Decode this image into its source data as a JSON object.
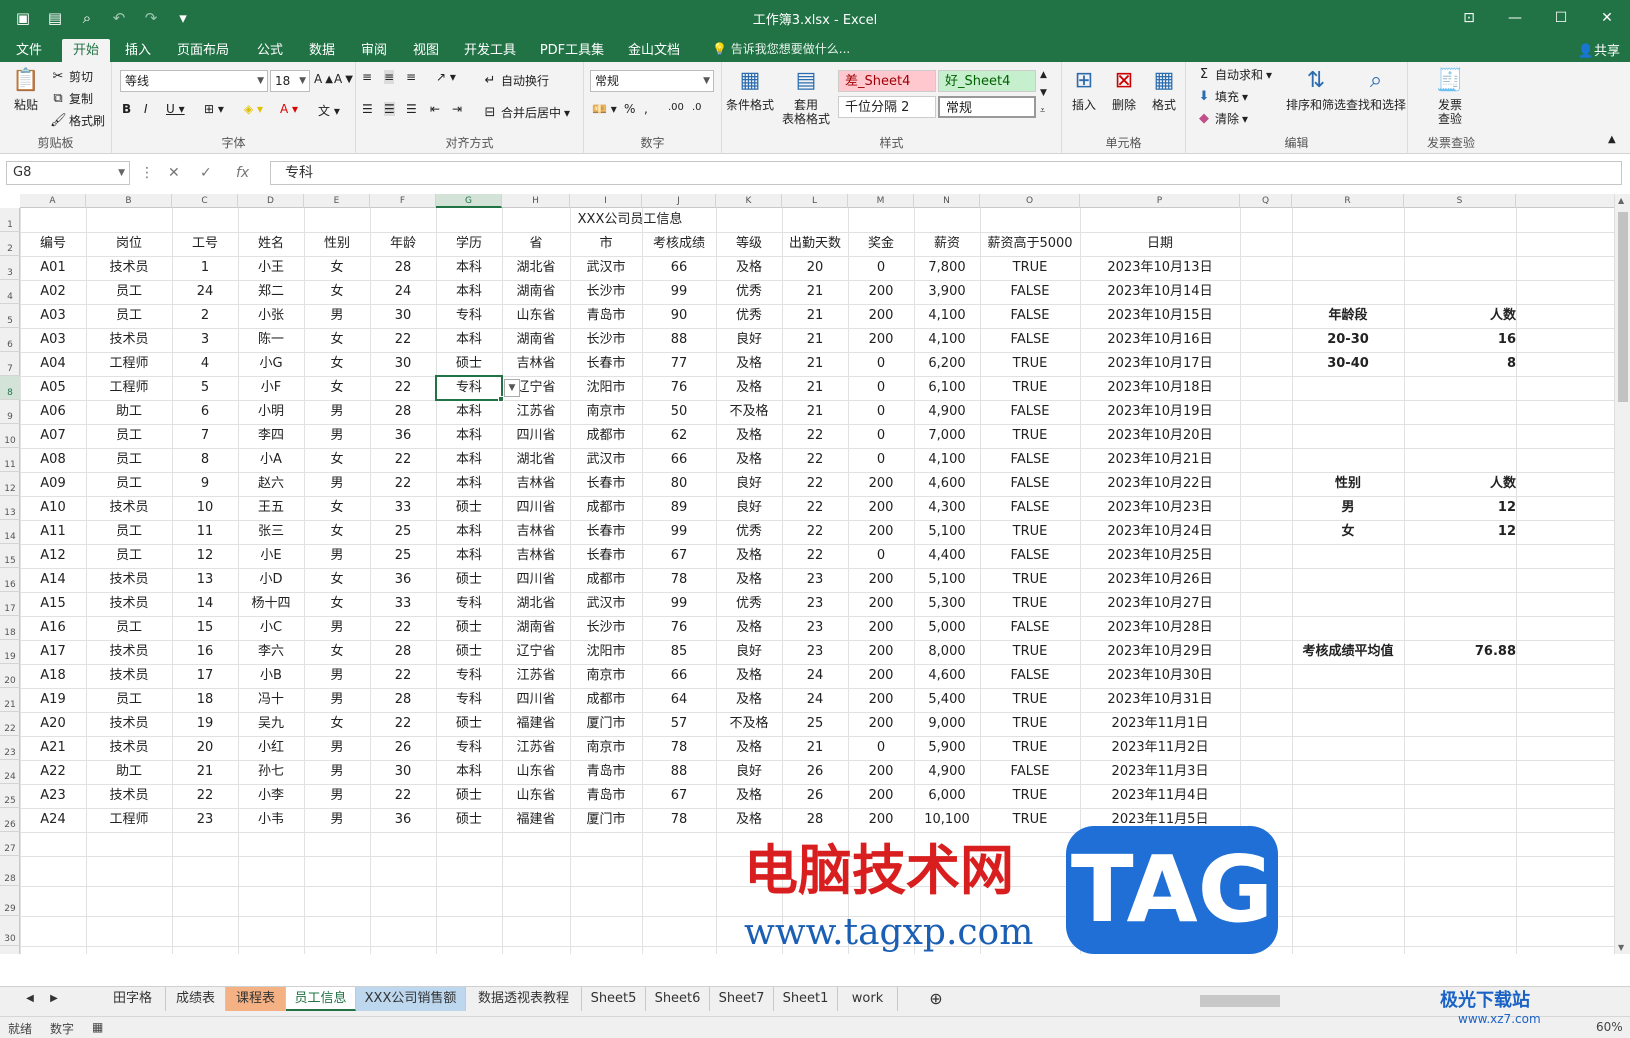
{
  "window": {
    "title": "工作簿3.xlsx - Excel"
  },
  "menu": {
    "tabs": [
      "文件",
      "开始",
      "插入",
      "页面布局",
      "公式",
      "数据",
      "审阅",
      "视图",
      "开发工具",
      "PDF工具集",
      "金山文档"
    ],
    "active": "开始",
    "tell_me": "告诉我您想要做什么...",
    "share": "共享"
  },
  "ribbon": {
    "clipboard": {
      "label": "剪贴板",
      "paste": "粘贴",
      "cut": "剪切",
      "copy": "复制",
      "format_painter": "格式刷"
    },
    "font": {
      "label": "字体",
      "name": "等线",
      "size": "18"
    },
    "align": {
      "label": "对齐方式",
      "wrap": "自动换行",
      "merge": "合并后居中"
    },
    "number": {
      "label": "数字",
      "format": "常规"
    },
    "styles": {
      "label": "样式",
      "cond": "条件格式",
      "table": "套用\n表格格式",
      "s1": "差_Sheet4",
      "s2": "好_Sheet4",
      "s3": "千位分隔 2",
      "s4": "常规"
    },
    "cells": {
      "label": "单元格",
      "insert": "插入",
      "delete": "删除",
      "format": "格式"
    },
    "edit": {
      "label": "编辑",
      "autosum": "自动求和",
      "fill": "填充",
      "clear": "清除",
      "sort": "排序和筛选",
      "find": "查找和选择"
    },
    "invoice": {
      "label": "发票查验",
      "btn": "发票\n查验"
    }
  },
  "formula_bar": {
    "name_box": "G8",
    "content": "专科"
  },
  "sheet": {
    "title": "XXX公司员工信息",
    "headers": [
      "编号",
      "岗位",
      "工号",
      "姓名",
      "性别",
      "年龄",
      "学历",
      "省",
      "市",
      "考核成绩",
      "等级",
      "出勤天数",
      "奖金",
      "薪资",
      "薪资高于5000",
      "日期"
    ],
    "rows": [
      [
        "A01",
        "技术员",
        "1",
        "小王",
        "女",
        "28",
        "本科",
        "湖北省",
        "武汉市",
        "66",
        "及格",
        "20",
        "0",
        "7,800",
        "TRUE",
        "2023年10月13日"
      ],
      [
        "A02",
        "员工",
        "24",
        "郑二",
        "女",
        "24",
        "本科",
        "湖南省",
        "长沙市",
        "99",
        "优秀",
        "21",
        "200",
        "3,900",
        "FALSE",
        "2023年10月14日"
      ],
      [
        "A03",
        "员工",
        "2",
        "小张",
        "男",
        "30",
        "专科",
        "山东省",
        "青岛市",
        "90",
        "优秀",
        "21",
        "200",
        "4,100",
        "FALSE",
        "2023年10月15日"
      ],
      [
        "A03",
        "技术员",
        "3",
        "陈一",
        "女",
        "22",
        "本科",
        "湖南省",
        "长沙市",
        "88",
        "良好",
        "21",
        "200",
        "4,100",
        "FALSE",
        "2023年10月16日"
      ],
      [
        "A04",
        "工程师",
        "4",
        "小G",
        "女",
        "30",
        "硕士",
        "吉林省",
        "长春市",
        "77",
        "及格",
        "21",
        "0",
        "6,200",
        "TRUE",
        "2023年10月17日"
      ],
      [
        "A05",
        "工程师",
        "5",
        "小F",
        "女",
        "22",
        "专科",
        "辽宁省",
        "沈阳市",
        "76",
        "及格",
        "21",
        "0",
        "6,100",
        "TRUE",
        "2023年10月18日"
      ],
      [
        "A06",
        "助工",
        "6",
        "小明",
        "男",
        "28",
        "本科",
        "江苏省",
        "南京市",
        "50",
        "不及格",
        "21",
        "0",
        "4,900",
        "FALSE",
        "2023年10月19日"
      ],
      [
        "A07",
        "员工",
        "7",
        "李四",
        "男",
        "36",
        "本科",
        "四川省",
        "成都市",
        "62",
        "及格",
        "22",
        "0",
        "7,000",
        "TRUE",
        "2023年10月20日"
      ],
      [
        "A08",
        "员工",
        "8",
        "小A",
        "女",
        "22",
        "本科",
        "湖北省",
        "武汉市",
        "66",
        "及格",
        "22",
        "0",
        "4,100",
        "FALSE",
        "2023年10月21日"
      ],
      [
        "A09",
        "员工",
        "9",
        "赵六",
        "男",
        "22",
        "本科",
        "吉林省",
        "长春市",
        "80",
        "良好",
        "22",
        "200",
        "4,600",
        "FALSE",
        "2023年10月22日"
      ],
      [
        "A10",
        "技术员",
        "10",
        "王五",
        "女",
        "33",
        "硕士",
        "四川省",
        "成都市",
        "89",
        "良好",
        "22",
        "200",
        "4,300",
        "FALSE",
        "2023年10月23日"
      ],
      [
        "A11",
        "员工",
        "11",
        "张三",
        "女",
        "25",
        "本科",
        "吉林省",
        "长春市",
        "99",
        "优秀",
        "22",
        "200",
        "5,100",
        "TRUE",
        "2023年10月24日"
      ],
      [
        "A12",
        "员工",
        "12",
        "小E",
        "男",
        "25",
        "本科",
        "吉林省",
        "长春市",
        "67",
        "及格",
        "22",
        "0",
        "4,400",
        "FALSE",
        "2023年10月25日"
      ],
      [
        "A14",
        "技术员",
        "13",
        "小D",
        "女",
        "36",
        "硕士",
        "四川省",
        "成都市",
        "78",
        "及格",
        "23",
        "200",
        "5,100",
        "TRUE",
        "2023年10月26日"
      ],
      [
        "A15",
        "技术员",
        "14",
        "杨十四",
        "女",
        "33",
        "专科",
        "湖北省",
        "武汉市",
        "99",
        "优秀",
        "23",
        "200",
        "5,300",
        "TRUE",
        "2023年10月27日"
      ],
      [
        "A16",
        "员工",
        "15",
        "小C",
        "男",
        "22",
        "硕士",
        "湖南省",
        "长沙市",
        "76",
        "及格",
        "23",
        "200",
        "5,000",
        "FALSE",
        "2023年10月28日"
      ],
      [
        "A17",
        "技术员",
        "16",
        "李六",
        "女",
        "28",
        "硕士",
        "辽宁省",
        "沈阳市",
        "85",
        "良好",
        "23",
        "200",
        "8,000",
        "TRUE",
        "2023年10月29日"
      ],
      [
        "A18",
        "技术员",
        "17",
        "小B",
        "男",
        "22",
        "专科",
        "江苏省",
        "南京市",
        "66",
        "及格",
        "24",
        "200",
        "4,600",
        "FALSE",
        "2023年10月30日"
      ],
      [
        "A19",
        "员工",
        "18",
        "冯十",
        "男",
        "28",
        "专科",
        "四川省",
        "成都市",
        "64",
        "及格",
        "24",
        "200",
        "5,400",
        "TRUE",
        "2023年10月31日"
      ],
      [
        "A20",
        "技术员",
        "19",
        "吴九",
        "女",
        "22",
        "硕士",
        "福建省",
        "厦门市",
        "57",
        "不及格",
        "25",
        "200",
        "9,000",
        "TRUE",
        "2023年11月1日"
      ],
      [
        "A21",
        "技术员",
        "20",
        "小红",
        "男",
        "26",
        "专科",
        "江苏省",
        "南京市",
        "78",
        "及格",
        "21",
        "0",
        "5,900",
        "TRUE",
        "2023年11月2日"
      ],
      [
        "A22",
        "助工",
        "21",
        "孙七",
        "男",
        "30",
        "本科",
        "山东省",
        "青岛市",
        "88",
        "良好",
        "26",
        "200",
        "4,900",
        "FALSE",
        "2023年11月3日"
      ],
      [
        "A23",
        "技术员",
        "22",
        "小李",
        "男",
        "22",
        "硕士",
        "山东省",
        "青岛市",
        "67",
        "及格",
        "26",
        "200",
        "6,000",
        "TRUE",
        "2023年11月4日"
      ],
      [
        "A24",
        "工程师",
        "23",
        "小韦",
        "男",
        "36",
        "硕士",
        "福建省",
        "厦门市",
        "78",
        "及格",
        "28",
        "200",
        "10,100",
        "TRUE",
        "2023年11月5日"
      ]
    ],
    "side": {
      "age_header": [
        "年龄段",
        "人数"
      ],
      "age_rows": [
        [
          "20-30",
          "16"
        ],
        [
          "30-40",
          "8"
        ]
      ],
      "gender_header": [
        "性别",
        "人数"
      ],
      "gender_rows": [
        [
          "男",
          "12"
        ],
        [
          "女",
          "12"
        ]
      ],
      "avg_label": "考核成绩平均值",
      "avg_value": "76.88"
    }
  },
  "sheet_tabs": [
    "田字格",
    "成绩表",
    "课程表",
    "员工信息",
    "XXX公司销售额",
    "数据透视表教程",
    "Sheet5",
    "Sheet6",
    "Sheet7",
    "Sheet1",
    "work"
  ],
  "active_sheet": "员工信息",
  "status": {
    "ready": "就绪",
    "mode": "数字",
    "zoom": "60%"
  },
  "watermark": {
    "site_cn": "电脑技术网",
    "tag": "TAG",
    "url": "www.tagxp.com",
    "corner": "极光下载站",
    "corner_url": "www.xz7.com"
  },
  "colors": {
    "excel_green": "#217346",
    "bad_style": "#ffc7ce",
    "good_style": "#c6efce"
  }
}
